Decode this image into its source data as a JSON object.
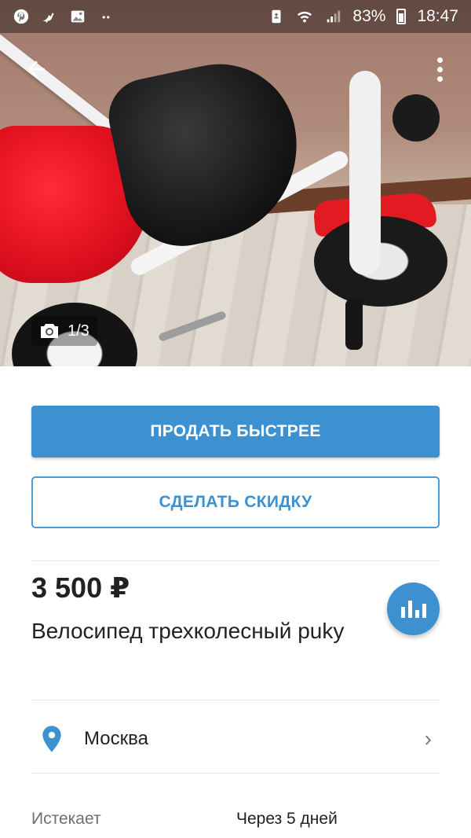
{
  "status_bar": {
    "left_icons": [
      "pinterest-icon",
      "bird-icon",
      "image-icon",
      "dots-icon"
    ],
    "right_icons": [
      "recycle-battery-icon",
      "wifi-icon",
      "signal-icon"
    ],
    "battery_percent": "83%",
    "time": "18:47"
  },
  "gallery": {
    "counter": "1/3",
    "back_icon": "arrow-left-icon",
    "more_icon": "more-vertical-icon",
    "camera_icon": "camera-icon"
  },
  "actions": {
    "sell_faster": "ПРОДАТЬ БЫСТРЕЕ",
    "make_discount": "СДЕЛАТЬ СКИДКУ"
  },
  "listing": {
    "price": "3 500 ₽",
    "title": "Велосипед трехколесный puky",
    "stats_icon": "bar-chart-icon"
  },
  "location": {
    "icon": "map-pin-icon",
    "city": "Москва",
    "chevron": "›"
  },
  "expires": {
    "label": "Истекает",
    "value": "Через 5 дней"
  },
  "colors": {
    "accent": "#3d91d1",
    "accent_border": "#4a9ad6"
  }
}
